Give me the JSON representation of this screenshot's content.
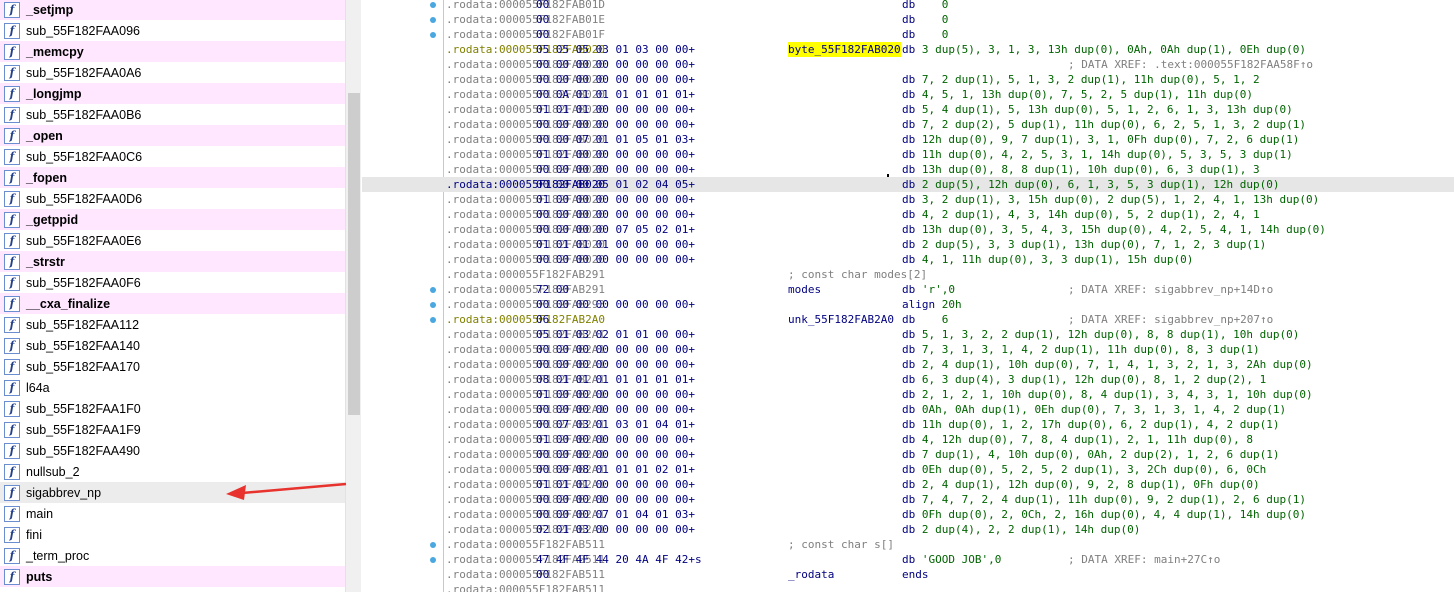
{
  "function_list": [
    {
      "name": "_setjmp",
      "lib": true
    },
    {
      "name": "sub_55F182FAA096",
      "lib": false
    },
    {
      "name": "_memcpy",
      "lib": true
    },
    {
      "name": "sub_55F182FAA0A6",
      "lib": false
    },
    {
      "name": "_longjmp",
      "lib": true
    },
    {
      "name": "sub_55F182FAA0B6",
      "lib": false
    },
    {
      "name": "_open",
      "lib": true
    },
    {
      "name": "sub_55F182FAA0C6",
      "lib": false
    },
    {
      "name": "_fopen",
      "lib": true
    },
    {
      "name": "sub_55F182FAA0D6",
      "lib": false
    },
    {
      "name": "_getppid",
      "lib": true
    },
    {
      "name": "sub_55F182FAA0E6",
      "lib": false
    },
    {
      "name": "_strstr",
      "lib": true
    },
    {
      "name": "sub_55F182FAA0F6",
      "lib": false
    },
    {
      "name": "__cxa_finalize",
      "lib": true
    },
    {
      "name": "sub_55F182FAA112",
      "lib": false
    },
    {
      "name": "sub_55F182FAA140",
      "lib": false
    },
    {
      "name": "sub_55F182FAA170",
      "lib": false
    },
    {
      "name": "l64a",
      "lib": false
    },
    {
      "name": "sub_55F182FAA1F0",
      "lib": false
    },
    {
      "name": "sub_55F182FAA1F9",
      "lib": false
    },
    {
      "name": "sub_55F182FAA490",
      "lib": false
    },
    {
      "name": "nullsub_2",
      "lib": false
    },
    {
      "name": "sigabbrev_np",
      "lib": false,
      "selected": true
    },
    {
      "name": "main",
      "lib": false
    },
    {
      "name": "fini",
      "lib": false
    },
    {
      "name": "_term_proc",
      "lib": false
    },
    {
      "name": "puts",
      "lib": true
    }
  ],
  "function_icon_glyph": "f",
  "disasm_lines": [
    {
      "addr": ".rodata:000055F182FAB01D",
      "bytes": "00",
      "label": "",
      "mnem": "db",
      "ops": "    0",
      "xref": "",
      "bp": true
    },
    {
      "addr": ".rodata:000055F182FAB01E",
      "bytes": "00",
      "label": "",
      "mnem": "db",
      "ops": "    0",
      "xref": "",
      "bp": true
    },
    {
      "addr": ".rodata:000055F182FAB01F",
      "bytes": "00",
      "label": "",
      "mnem": "db",
      "ops": "    0",
      "xref": "",
      "bp": true
    },
    {
      "addr": ".rodata:000055F182FAB020",
      "bytes": "05 05 05 03 01 03 00 00+",
      "label": "byte_55F182FAB020",
      "label_hl": true,
      "mnem": "db",
      "ops": " 3 dup(5), 3, 1, 3, 13h dup(0), 0Ah, 0Ah dup(1), 0Eh dup(0)",
      "xref": "",
      "olive": true
    },
    {
      "addr": ".rodata:000055F182FAB020",
      "bytes": "00 00 00 00 00 00 00 00+",
      "label": "",
      "mnem": "",
      "ops": "",
      "xref": "; DATA XREF: .text:000055F182FAA58F↑o"
    },
    {
      "addr": ".rodata:000055F182FAB020",
      "bytes": "00 00 00 00 00 00 00 00+",
      "label": "",
      "mnem": "db",
      "ops": " 7, 2 dup(1), 5, 1, 3, 2 dup(1), 11h dup(0), 5, 1, 2",
      "xref": ""
    },
    {
      "addr": ".rodata:000055F182FAB020",
      "bytes": "00 0A 01 01 01 01 01 01+",
      "label": "",
      "mnem": "db",
      "ops": " 4, 5, 1, 13h dup(0), 7, 5, 2, 5 dup(1), 11h dup(0)",
      "xref": ""
    },
    {
      "addr": ".rodata:000055F182FAB020",
      "bytes": "01 01 01 00 00 00 00 00+",
      "label": "",
      "mnem": "db",
      "ops": " 5, 4 dup(1), 5, 13h dup(0), 5, 1, 2, 6, 1, 3, 13h dup(0)",
      "xref": ""
    },
    {
      "addr": ".rodata:000055F182FAB020",
      "bytes": "00 00 00 00 00 00 00 00+",
      "label": "",
      "mnem": "db",
      "ops": " 7, 2 dup(2), 5 dup(1), 11h dup(0), 6, 2, 5, 1, 3, 2 dup(1)",
      "xref": ""
    },
    {
      "addr": ".rodata:000055F182FAB020",
      "bytes": "00 00 07 01 01 05 01 03+",
      "label": "",
      "mnem": "db",
      "ops": " 12h dup(0), 9, 7 dup(1), 3, 1, 0Fh dup(0), 7, 2, 6 dup(1)",
      "xref": ""
    },
    {
      "addr": ".rodata:000055F182FAB020",
      "bytes": "01 01 00 00 00 00 00 00+",
      "label": "",
      "mnem": "db",
      "ops": " 11h dup(0), 4, 2, 5, 3, 1, 14h dup(0), 5, 3, 5, 3 dup(1)",
      "xref": ""
    },
    {
      "addr": ".rodata:000055F182FAB020",
      "bytes": "00 00 00 00 00 00 00 00+",
      "label": "",
      "mnem": "db",
      "ops": " 13h dup(0), 8, 8 dup(1), 10h dup(0), 6, 3 dup(1), 3",
      "xref": ""
    },
    {
      "addr": ".rodata:000055F182FAB020",
      "bytes": "00 00 00 05 01 02 04 05+",
      "label": "",
      "mnem": "db",
      "ops": " 2 dup(5), 12h dup(0), 6, 1, 3, 5, 3 dup(1), 12h dup(0)",
      "xref": "",
      "current": true
    },
    {
      "addr": ".rodata:000055F182FAB020",
      "bytes": "01 00 00 00 00 00 00 00+",
      "label": "",
      "mnem": "db",
      "ops": " 3, 2 dup(1), 3, 15h dup(0), 2 dup(5), 1, 2, 4, 1, 13h dup(0)",
      "xref": ""
    },
    {
      "addr": ".rodata:000055F182FAB020",
      "bytes": "00 00 00 00 00 00 00 00+",
      "label": "",
      "mnem": "db",
      "ops": " 4, 2 dup(1), 4, 3, 14h dup(0), 5, 2 dup(1), 2, 4, 1",
      "xref": ""
    },
    {
      "addr": ".rodata:000055F182FAB020",
      "bytes": "00 00 00 00 07 05 02 01+",
      "label": "",
      "mnem": "db",
      "ops": " 13h dup(0), 3, 5, 4, 3, 15h dup(0), 4, 2, 5, 4, 1, 14h dup(0)",
      "xref": ""
    },
    {
      "addr": ".rodata:000055F182FAB020",
      "bytes": "01 01 01 01 00 00 00 00+",
      "label": "",
      "mnem": "db",
      "ops": " 2 dup(5), 3, 3 dup(1), 13h dup(0), 7, 1, 2, 3 dup(1)",
      "xref": ""
    },
    {
      "addr": ".rodata:000055F182FAB020",
      "bytes": "00 00 00 00 00 00 00 00+",
      "label": "",
      "mnem": "db",
      "ops": " 4, 1, 11h dup(0), 3, 3 dup(1), 15h dup(0)",
      "xref": ""
    },
    {
      "addr": ".rodata:000055F182FAB291",
      "bytes": "",
      "label": "",
      "mnem": "",
      "ops": "",
      "xref": "",
      "comment": "; const char modes[2]"
    },
    {
      "addr": ".rodata:000055F182FAB291",
      "bytes": "72 00",
      "label": "modes",
      "mnem": "db",
      "ops": " 'r',0",
      "xref": "; DATA XREF: sigabbrev_np+14D↑o",
      "bp": true
    },
    {
      "addr": ".rodata:000055F182FAB293",
      "bytes": "00 00 00 00 00 00 00 00+",
      "label": "",
      "mnem": "align",
      "ops": " 20h",
      "xref": "",
      "bp": true
    },
    {
      "addr": ".rodata:000055F182FAB2A0",
      "bytes": "06",
      "label": "unk_55F182FAB2A0",
      "mnem": "db",
      "ops": "    6",
      "xref": "; DATA XREF: sigabbrev_np+207↑o",
      "olive": true,
      "bp": true
    },
    {
      "addr": ".rodata:000055F182FAB2A1",
      "bytes": "05 01 03 02 01 01 00 00+",
      "label": "",
      "mnem": "db",
      "ops": " 5, 1, 3, 2, 2 dup(1), 12h dup(0), 8, 8 dup(1), 10h dup(0)",
      "xref": ""
    },
    {
      "addr": ".rodata:000055F182FAB2A1",
      "bytes": "00 00 00 00 00 00 00 00+",
      "label": "",
      "mnem": "db",
      "ops": " 7, 3, 1, 3, 1, 4, 2 dup(1), 11h dup(0), 8, 3 dup(1)",
      "xref": ""
    },
    {
      "addr": ".rodata:000055F182FAB2A1",
      "bytes": "00 00 00 00 00 00 00 00+",
      "label": "",
      "mnem": "db",
      "ops": " 2, 4 dup(1), 10h dup(0), 7, 1, 4, 1, 3, 2, 1, 3, 2Ah dup(0)",
      "xref": ""
    },
    {
      "addr": ".rodata:000055F182FAB2A1",
      "bytes": "08 01 01 01 01 01 01 01+",
      "label": "",
      "mnem": "db",
      "ops": " 6, 3 dup(4), 3 dup(1), 12h dup(0), 8, 1, 2 dup(2), 1",
      "xref": ""
    },
    {
      "addr": ".rodata:000055F182FAB2A1",
      "bytes": "01 00 00 00 00 00 00 00+",
      "label": "",
      "mnem": "db",
      "ops": " 2, 1, 2, 1, 10h dup(0), 8, 4 dup(1), 3, 4, 3, 1, 10h dup(0)",
      "xref": ""
    },
    {
      "addr": ".rodata:000055F182FAB2A1",
      "bytes": "00 00 00 00 00 00 00 00+",
      "label": "",
      "mnem": "db",
      "ops": " 0Ah, 0Ah dup(1), 0Eh dup(0), 7, 3, 1, 3, 1, 4, 2 dup(1)",
      "xref": ""
    },
    {
      "addr": ".rodata:000055F182FAB2A1",
      "bytes": "00 07 03 01 03 01 04 01+",
      "label": "",
      "mnem": "db",
      "ops": " 11h dup(0), 1, 2, 17h dup(0), 6, 2 dup(1), 4, 2 dup(1)",
      "xref": ""
    },
    {
      "addr": ".rodata:000055F182FAB2A1",
      "bytes": "01 00 00 00 00 00 00 00+",
      "label": "",
      "mnem": "db",
      "ops": " 4, 12h dup(0), 7, 8, 4 dup(1), 2, 1, 11h dup(0), 8",
      "xref": ""
    },
    {
      "addr": ".rodata:000055F182FAB2A1",
      "bytes": "00 00 00 00 00 00 00 00+",
      "label": "",
      "mnem": "db",
      "ops": " 7 dup(1), 4, 10h dup(0), 0Ah, 2 dup(2), 1, 2, 6 dup(1)",
      "xref": ""
    },
    {
      "addr": ".rodata:000055F182FAB2A1",
      "bytes": "00 00 08 01 01 01 02 01+",
      "label": "",
      "mnem": "db",
      "ops": " 0Eh dup(0), 5, 2, 5, 2 dup(1), 3, 2Ch dup(0), 6, 0Ch",
      "xref": ""
    },
    {
      "addr": ".rodata:000055F182FAB2A1",
      "bytes": "01 01 01 00 00 00 00 00+",
      "label": "",
      "mnem": "db",
      "ops": " 2, 4 dup(1), 12h dup(0), 9, 2, 8 dup(1), 0Fh dup(0)",
      "xref": ""
    },
    {
      "addr": ".rodata:000055F182FAB2A1",
      "bytes": "00 00 00 00 00 00 00 00+",
      "label": "",
      "mnem": "db",
      "ops": " 7, 4, 7, 2, 4 dup(1), 11h dup(0), 9, 2 dup(1), 2, 6 dup(1)",
      "xref": ""
    },
    {
      "addr": ".rodata:000055F182FAB2A1",
      "bytes": "00 00 00 07 01 04 01 03+",
      "label": "",
      "mnem": "db",
      "ops": " 0Fh dup(0), 2, 0Ch, 2, 16h dup(0), 4, 4 dup(1), 14h dup(0)",
      "xref": ""
    },
    {
      "addr": ".rodata:000055F182FAB2A1",
      "bytes": "02 01 03 00 00 00 00 00+",
      "label": "",
      "mnem": "db",
      "ops": " 2 dup(4), 2, 2 dup(1), 14h dup(0)",
      "xref": ""
    },
    {
      "addr": ".rodata:000055F182FAB511",
      "bytes": "",
      "label": "",
      "mnem": "",
      "ops": "",
      "xref": "",
      "comment": "; const char s[]",
      "bp": true
    },
    {
      "addr": ".rodata:000055F182FAB511",
      "bytes": "47 4F 4F 44 20 4A 4F 42+s",
      "label": "",
      "mnem": "db",
      "ops": " 'GOOD JOB',0",
      "xref": "; DATA XREF: main+27C↑o",
      "bp": true
    },
    {
      "addr": ".rodata:000055F182FAB511",
      "bytes": "00",
      "label": "_rodata",
      "mnem": "ends",
      "ops": "",
      "xref": ""
    },
    {
      "addr": ".rodata:000055F182FAB511",
      "bytes": "",
      "label": "",
      "mnem": "",
      "ops": "",
      "xref": ""
    }
  ],
  "colors": {
    "lib_row_bg": "#ffe8ff",
    "selected_row_bg": "#ececec",
    "highlight_label_bg": "#ffff00",
    "address_gray": "#7f7f7f",
    "code_navy": "#000080",
    "operand_green": "#006400",
    "breakpoint_dot": "#4aa7e0",
    "arrow_red": "#e8322d"
  },
  "icons": {
    "function_icon": "function-icon",
    "annotation_arrow": "red-arrow-icon",
    "breakpoint_marker": "breakpoint-dot-icon"
  }
}
